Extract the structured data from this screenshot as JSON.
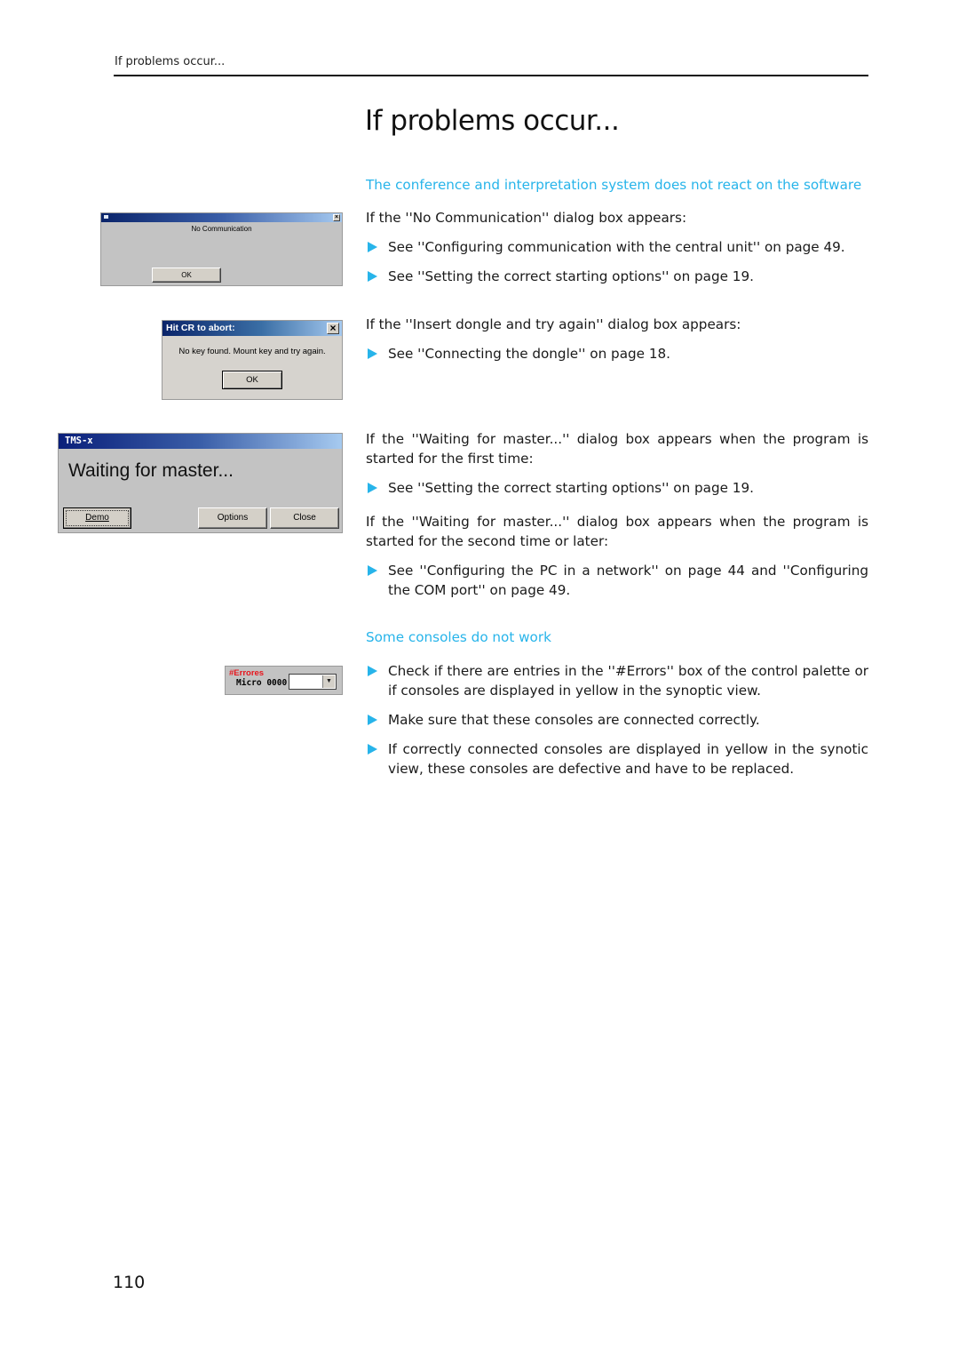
{
  "header": {
    "running_head": "If problems occur...",
    "title": "If problems occur..."
  },
  "colors": {
    "accent": "#27b4ea",
    "titlebar_dark": "#0a246a",
    "titlebar_light": "#a6caf0",
    "dialog_face": "#c3c3c3",
    "error_label": "#e8141c"
  },
  "sections": {
    "no_react": {
      "heading": "The conference and interpretation system does not react on the software",
      "no_comm_intro": "If the ''No Communication'' dialog box appears:",
      "no_comm_bullets": [
        "See ''Configuring communication with the central unit'' on page 49.",
        "See ''Setting the correct starting options'' on page 19."
      ],
      "dongle_intro": "If the ''Insert dongle and try again'' dialog box appears:",
      "dongle_bullets": [
        "See ''Connecting the dongle'' on page 18."
      ],
      "waiting_first_intro": "If the ''Waiting for master...'' dialog box appears when the program is started for the first time:",
      "waiting_first_bullets": [
        "See ''Setting the correct starting options'' on page 19."
      ],
      "waiting_second_intro": "If the ''Waiting for master...'' dialog box appears when the program is started for the second time or later:",
      "waiting_second_bullets": [
        "See ''Configuring the PC in a network'' on page 44 and ''Configuring the COM port'' on page 49."
      ]
    },
    "consoles": {
      "heading": "Some consoles do not work",
      "bullets": [
        "Check if there are entries in the ''#Errors'' box of the control palette or if consoles are displayed in yellow in the synoptic view.",
        "Make sure that these consoles are connected correctly.",
        "If correctly connected consoles are displayed in yellow in the synotic view, these consoles are defective and have to be replaced."
      ]
    }
  },
  "dialogs": {
    "no_communication": {
      "title": "",
      "message": "No Communication",
      "ok_label": "OK",
      "close_glyph": "×"
    },
    "dongle": {
      "title": "Hit CR to abort:",
      "message": "No key found. Mount key and try again.",
      "ok_label": "OK",
      "close_glyph": "×"
    },
    "waiting": {
      "title": "TMS-x",
      "message": "Waiting for master...",
      "buttons": [
        "Demo",
        "Options",
        "Close"
      ]
    },
    "errors_palette": {
      "label": "#Errores",
      "micro_label": "Micro 0000",
      "value": "",
      "dropdown_glyph": "▼"
    }
  },
  "footer": {
    "page_number": "110"
  }
}
